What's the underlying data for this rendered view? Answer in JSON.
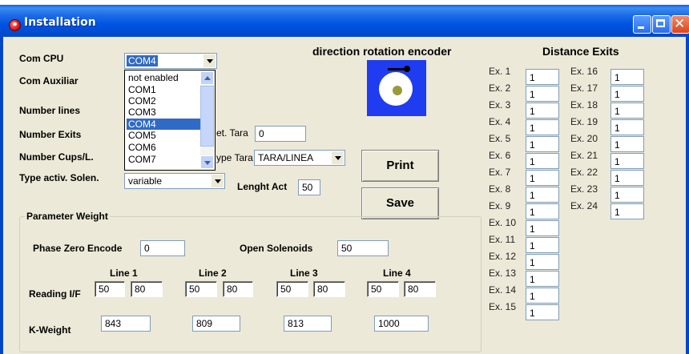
{
  "window": {
    "title": "Installation"
  },
  "labels": {
    "com_cpu": "Com CPU",
    "com_aux": "Com Auxiliar",
    "number_lines": "Number lines",
    "number_exits": "Number Exits",
    "number_cups": "Number Cups/L.",
    "type_activ": "Type activ. Solen.",
    "direction": "direction rotation encoder",
    "distance_exits": "Distance Exits",
    "set_tara": "et. Tara",
    "type_tara": "ype Tara",
    "lenght_act": "Lenght Act",
    "param_weight": "Parameter Weight",
    "phase_zero": "Phase Zero Encode",
    "open_solenoids": "Open Solenoids",
    "reading_if": "Reading I/F",
    "k_weight": "K-Weight"
  },
  "values": {
    "com_cpu": "COM4",
    "set_tara": "0",
    "type_tara": "TARA/LINEA",
    "type_activ": "variable",
    "lenght_act": "50",
    "phase_zero": "0",
    "open_solenoids": "50"
  },
  "dropdown": {
    "options": [
      "not enabled",
      "COM1",
      "COM2",
      "COM3",
      "COM4",
      "COM5",
      "COM6",
      "COM7"
    ],
    "selected": "COM4"
  },
  "buttons": {
    "print": "Print",
    "save": "Save"
  },
  "lines": [
    {
      "label": "Line 1",
      "reading_a": "50",
      "reading_b": "80",
      "k_weight": "843"
    },
    {
      "label": "Line 2",
      "reading_a": "50",
      "reading_b": "80",
      "k_weight": "809"
    },
    {
      "label": "Line 3",
      "reading_a": "50",
      "reading_b": "80",
      "k_weight": "813"
    },
    {
      "label": "Line 4",
      "reading_a": "50",
      "reading_b": "80",
      "k_weight": "1000"
    }
  ],
  "exits": [
    {
      "label": "Ex. 1",
      "value": "1"
    },
    {
      "label": "Ex. 2",
      "value": "1"
    },
    {
      "label": "Ex. 3",
      "value": "1"
    },
    {
      "label": "Ex. 4",
      "value": "1"
    },
    {
      "label": "Ex. 5",
      "value": "1"
    },
    {
      "label": "Ex. 6",
      "value": "1"
    },
    {
      "label": "Ex. 7",
      "value": "1"
    },
    {
      "label": "Ex. 8",
      "value": "1"
    },
    {
      "label": "Ex. 9",
      "value": "1"
    },
    {
      "label": "Ex. 10",
      "value": "1"
    },
    {
      "label": "Ex. 11",
      "value": "1"
    },
    {
      "label": "Ex. 12",
      "value": "1"
    },
    {
      "label": "Ex. 13",
      "value": "1"
    },
    {
      "label": "Ex. 14",
      "value": "1"
    },
    {
      "label": "Ex. 15",
      "value": "1"
    },
    {
      "label": "Ex. 16",
      "value": "1"
    },
    {
      "label": "Ex. 17",
      "value": "1"
    },
    {
      "label": "Ex. 18",
      "value": "1"
    },
    {
      "label": "Ex. 19",
      "value": "1"
    },
    {
      "label": "Ex. 20",
      "value": "1"
    },
    {
      "label": "Ex. 21",
      "value": "1"
    },
    {
      "label": "Ex. 22",
      "value": "1"
    },
    {
      "label": "Ex. 23",
      "value": "1"
    },
    {
      "label": "Ex. 24",
      "value": "1"
    }
  ],
  "icons": {
    "app": "tomato-app-icon",
    "minimize": "minimize-icon",
    "maximize": "maximize-icon",
    "close": "close-icon",
    "encoder": "encoder-rotation-icon"
  }
}
